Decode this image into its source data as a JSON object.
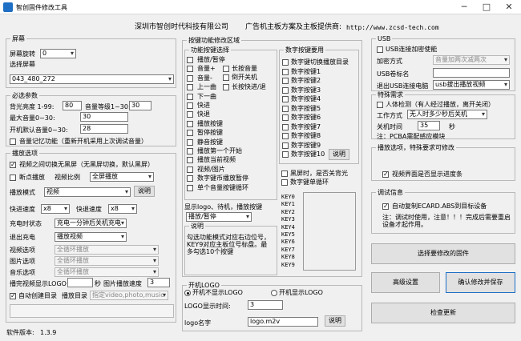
{
  "window": {
    "title": "智创固件修改工具",
    "minimize": "─",
    "maximize": "□",
    "close": "✕"
  },
  "header": {
    "company": "深圳市智创时代科技有限公司",
    "tagline": "广告机主板方案及主板提供商:",
    "url": "http://www.zcsd-tech.com"
  },
  "screen": {
    "group": "屏幕",
    "rotate_label": "屏幕旋转",
    "rotate_value": "0",
    "select_label": "选择屏幕",
    "select_value": "043_480_272"
  },
  "params": {
    "group": "必选参数",
    "backlight_label": "背光亮度 1-99:",
    "backlight_value": "80",
    "volume_level_label": "音量等级1~30:",
    "volume_level_value": "30",
    "max_volume_label": "最大音量0~30:",
    "max_volume_value": "30",
    "boot_volume_label": "开机默认音量0~30:",
    "boot_volume_value": "28",
    "memory_label": "音量记忆功能（重新开机采用上次调试音量）"
  },
  "playback": {
    "group": "播放选项",
    "auto_switch_label": "视频之间切换无黑屏（无黑屏切换，默认黑屏）",
    "resume_label": "断点播放",
    "ratio_label": "视频比例",
    "ratio_value": "全屏播放",
    "mode_label": "播放模式",
    "mode_value": "视频",
    "explain_button": "说明",
    "fast_speed_label": "快进速度",
    "fast_speed_value": "x8",
    "rewind_speed_label": "快退速度",
    "rewind_speed_value": "x8",
    "charge_state_label": "充电时状态",
    "charge_state_value": "充电一分钟后关机充电",
    "exit_charge_label": "退出充电",
    "exit_charge_value": "播放视频",
    "video_opt_label": "视频选项",
    "video_opt_value": "全循环播放",
    "picture_opt_label": "图片选项",
    "picture_opt_value": "全循环播放",
    "music_opt_label": "音乐选项",
    "music_opt_value": "全循环播放",
    "logo_interval_label": "播完视频显示LOGO",
    "logo_interval_unit": "秒",
    "pic_speed_label": "图片播放速度",
    "pic_speed_value": "3",
    "auto_dir_label": "自动创建目录",
    "dir_label": "播放目录",
    "dir_value": "指定video,photo,music"
  },
  "keys": {
    "group": "按键功能修改区域",
    "select_group": "功能按键选择",
    "col1": [
      "播放/暂停",
      "音量+",
      "音量-",
      "上一曲",
      "下一曲",
      "快进",
      "快退",
      "播放按键",
      "暂停按键",
      "静音按键",
      "播放第一个开始",
      "播放当前视频",
      "视频/图片",
      "数字键币播放暂停",
      "单个音量按键循环"
    ],
    "col2": [
      "长按音量",
      "倒开关机",
      "长按快进/退"
    ],
    "digit_group": "数字按键要用",
    "digits": [
      "数字键切换播放目录",
      "数字按键1",
      "数字按键2",
      "数字按键3",
      "数字按键4",
      "数字按键5",
      "数字按键6",
      "数字按键7",
      "数字按键8",
      "数字按键9",
      "数字按键10"
    ],
    "digit_explain": "说明",
    "black_label": "黑屏时，是否关背光",
    "single_loop_label": "数字键单循环",
    "logo_standby_label": "显示logo、待机，播放按键",
    "logo_standby_value": "播放/暂停",
    "notes_group": "说明",
    "notes": "勾选功能模式对应右边位号，KEY9对应主板位号标盘。最多勾选10个按键",
    "key_labels": [
      "KEY0",
      "KEY1",
      "KEY2",
      "KEY3",
      "KEY4",
      "KEY5",
      "KEY6",
      "KEY7",
      "KEY8",
      "KEY9"
    ]
  },
  "boot_logo": {
    "group": "开机LOGO",
    "no_logo_label": "开机不显示LOGO",
    "show_logo_label": "开机显示LOGO",
    "time_label": "LOGO显示时间:",
    "time_value": "3",
    "name_label": "logo名字",
    "name_value": "logo.m2v",
    "explain_button": "说明"
  },
  "usb": {
    "group": "USB",
    "encrypt_label": "USB连接加密使能",
    "method_label": "加密方式",
    "method_value": "音量加两次减两次",
    "volume_name_label": "USB卷标名",
    "exit_label": "退出USB连接电脑",
    "exit_value": "usb拔出播放视频"
  },
  "special": {
    "group": "特殊需求",
    "sensor_label": "人体检测（有人经过播放，离开关闭）",
    "mode_label": "工作方式",
    "mode_value": "无人时多少秒后关机",
    "off_time_label": "关机时间",
    "off_time_value": "35",
    "off_time_unit": "秒",
    "note": "注：PCBA需配感应模块"
  },
  "play_mode": {
    "group": "播放选项，特殊要求可修改",
    "video_interface_label": "视频界面是否显示进度条"
  },
  "debug": {
    "group": "调试信息",
    "auto_copy_label": "自动复制ECARD.ABS到目标设备",
    "note": "注：调试时使用，注意！！！完成后需要重启设备才起作用。"
  },
  "actions": {
    "select_firmware": "选择要修改的固件",
    "advanced": "高级设置",
    "confirm_save": "确认修改并保存",
    "check_update": "检查更新"
  },
  "footer": {
    "version_label": "软件版本:",
    "version_value": "1.3.9"
  },
  "colors": {
    "accent": "#1f6fc5"
  }
}
